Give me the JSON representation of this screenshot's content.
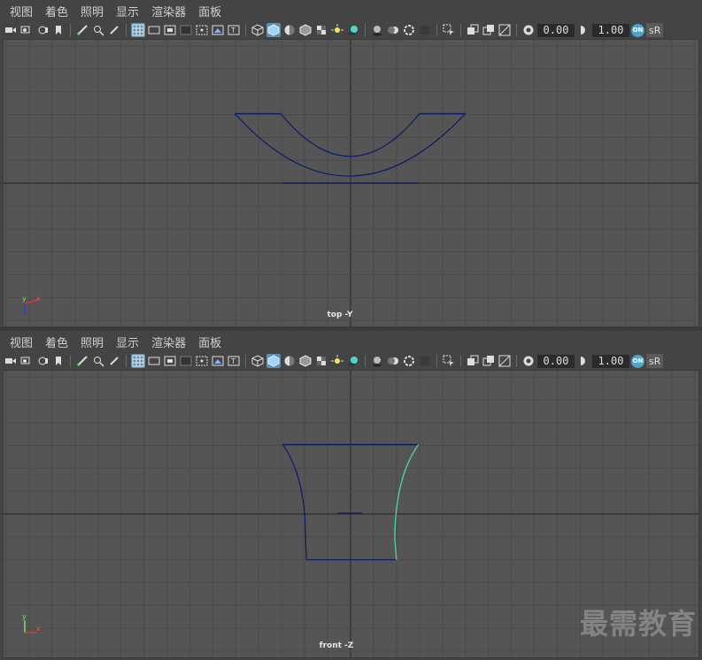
{
  "menu": [
    "视图",
    "着色",
    "照明",
    "显示",
    "渲染器",
    "面板"
  ],
  "toolbar": {
    "field1": "0.00",
    "field2": "1.00",
    "on_badge": "ON",
    "color_space": "sR"
  },
  "top_view": {
    "camera_label": "top -Y"
  },
  "front_view": {
    "camera_label": "front -Z"
  },
  "watermark": "最需教育",
  "colors": {
    "curve": "#0b1a66",
    "selected_curve": "#4dd8a8",
    "grid": "#4a4a4a",
    "axis": "#333333"
  }
}
